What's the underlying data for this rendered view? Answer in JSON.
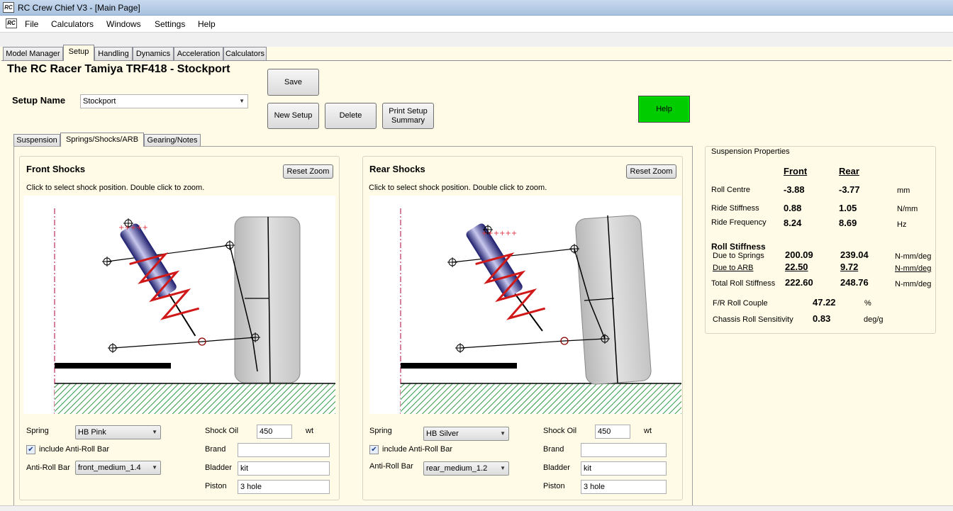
{
  "window": {
    "title": "RC Crew Chief V3 - [Main Page]",
    "icon_text": "RC"
  },
  "menu": [
    "File",
    "Calculators",
    "Windows",
    "Settings",
    "Help"
  ],
  "main_tabs": [
    "Model Manager",
    "Setup",
    "Handling",
    "Dynamics",
    "Acceleration",
    "Calculators"
  ],
  "model_title": "The RC Racer Tamiya TRF418 - Stockport",
  "setup": {
    "label": "Setup Name",
    "value": "Stockport"
  },
  "buttons": {
    "save": "Save",
    "new_setup": "New Setup",
    "delete": "Delete",
    "print": "Print Setup Summary",
    "help": "Help"
  },
  "sub_tabs": [
    "Suspension",
    "Springs/Shocks/ARB",
    "Gearing/Notes"
  ],
  "front": {
    "title": "Front Shocks",
    "reset": "Reset Zoom",
    "hint": "Click to select shock position. Double click to zoom.",
    "spring_label": "Spring",
    "spring": "HB Pink",
    "arb_check": "include Anti-Roll Bar",
    "arb_label": "Anti-Roll Bar",
    "arb": "front_medium_1.4",
    "oil_label": "Shock Oil",
    "oil": "450",
    "oil_unit": "wt",
    "brand_label": "Brand",
    "brand": "",
    "bladder_label": "Bladder",
    "bladder": "kit",
    "piston_label": "Piston",
    "piston": "3 hole"
  },
  "rear": {
    "title": "Rear Shocks",
    "reset": "Reset Zoom",
    "hint": "Click to select shock position. Double click to zoom.",
    "spring_label": "Spring",
    "spring": "HB Silver",
    "arb_check": "include Anti-Roll Bar",
    "arb_label": "Anti-Roll Bar",
    "arb": "rear_medium_1.2",
    "oil_label": "Shock Oil",
    "oil": "450",
    "oil_unit": "wt",
    "brand_label": "Brand",
    "brand": "",
    "bladder_label": "Bladder",
    "bladder": "kit",
    "piston_label": "Piston",
    "piston": "3 hole"
  },
  "props": {
    "title": "Suspension Properties",
    "col_front": "Front",
    "col_rear": "Rear",
    "roll_centre": {
      "label": "Roll Centre",
      "front": "-3.88",
      "rear": "-3.77",
      "unit": "mm"
    },
    "ride_stiffness": {
      "label": "Ride Stiffness",
      "front": "0.88",
      "rear": "1.05",
      "unit": "N/mm"
    },
    "ride_frequency": {
      "label": "Ride Frequency",
      "front": "8.24",
      "rear": "8.69",
      "unit": "Hz"
    },
    "roll_stiffness_heading": "Roll Stiffness",
    "due_springs": {
      "label": "Due to Springs",
      "front": "200.09",
      "rear": "239.04",
      "unit": "N-mm/deg"
    },
    "due_arb": {
      "label": "Due to ARB",
      "front": "22.50",
      "rear": "9.72",
      "unit": "N-mm/deg"
    },
    "total_roll": {
      "label": "Total Roll Stiffness",
      "front": "222.60",
      "rear": "248.76",
      "unit": "N-mm/deg"
    },
    "fr_roll_couple": {
      "label": "F/R Roll Couple",
      "value": "47.22",
      "unit": "%"
    },
    "chassis_roll": {
      "label": "Chassis Roll Sensitivity",
      "value": "0.83",
      "unit": "deg/g"
    }
  }
}
